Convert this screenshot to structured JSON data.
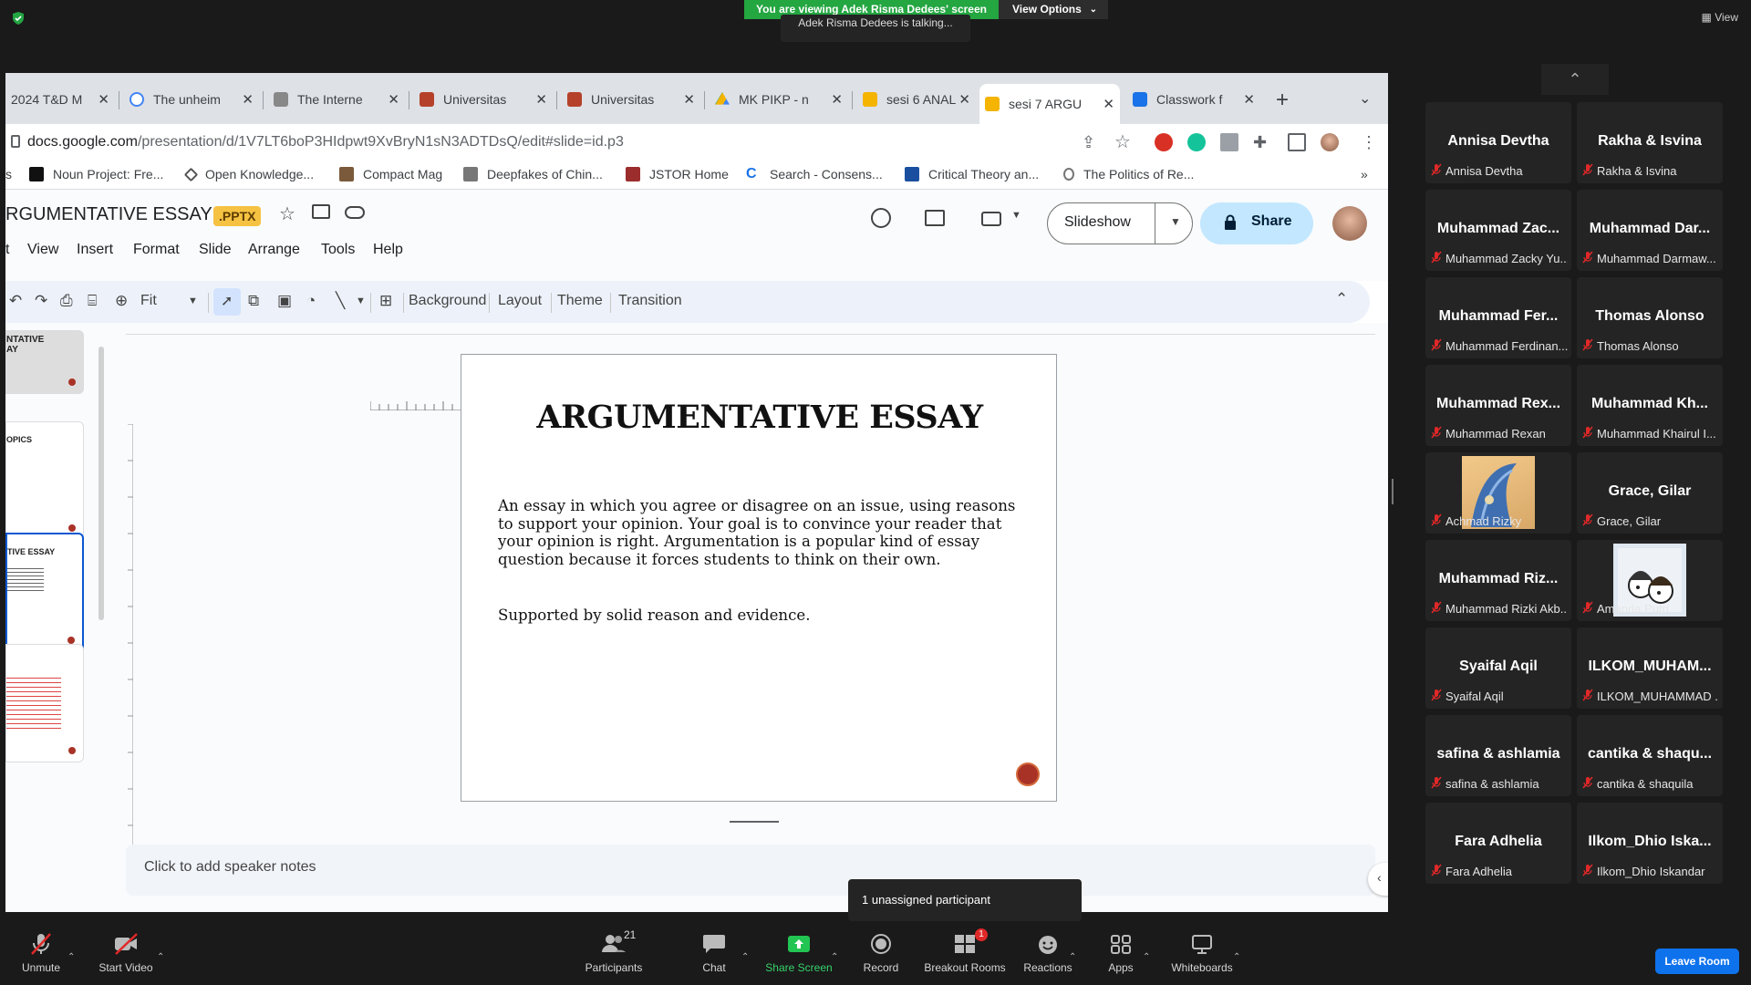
{
  "zoom": {
    "viewing_banner": "You are viewing Adek Risma Dedees' screen",
    "view_options": "View Options",
    "talking": "Adek Risma Dedees is talking...",
    "top_view": "View"
  },
  "browser": {
    "tabs": [
      {
        "label": "2024 T&D M",
        "color": "#c8c8c8"
      },
      {
        "label": "The unheim",
        "color": "#4285f4"
      },
      {
        "label": "The Interne",
        "color": "#888888"
      },
      {
        "label": "Universitas",
        "color": "#b5412a"
      },
      {
        "label": "Universitas",
        "color": "#b5412a"
      },
      {
        "label": "MK PIKP - n",
        "color": "#0f9d58"
      },
      {
        "label": "sesi 6 ANAL",
        "color": "#f4b400"
      },
      {
        "label": "sesi 7 ARGU",
        "color": "#f4b400"
      },
      {
        "label": "Classwork f",
        "color": "#1a73e8"
      }
    ],
    "url_host": "docs.google.com",
    "url_path": "/presentation/d/1V7LT6boP3HIdpwt9XvBryN1sN3ADTDsQ/edit#slide=id.p3",
    "bookmarks": [
      {
        "label": "s"
      },
      {
        "label": "Noun Project: Fre..."
      },
      {
        "label": "Open Knowledge..."
      },
      {
        "label": "Compact Mag"
      },
      {
        "label": "Deepfakes of Chin..."
      },
      {
        "label": "JSTOR Home"
      },
      {
        "label": "Search - Consens..."
      },
      {
        "label": "Critical Theory an..."
      },
      {
        "label": "The Politics of Re..."
      }
    ],
    "bookmarks_more": "»"
  },
  "slides": {
    "doc_title": "RGUMENTATIVE ESSAY",
    "badge": ".PPTX",
    "menus": [
      "t",
      "View",
      "Insert",
      "Format",
      "Slide",
      "Arrange",
      "Tools",
      "Help"
    ],
    "slideshow": "Slideshow",
    "share": "Share",
    "zoom": "Fit",
    "toolbar_text": [
      "Background",
      "Layout",
      "Theme",
      "Transition"
    ],
    "thumbnails": [
      "NTATIVE\nAY",
      "OPICS",
      "TIVE ESSAY",
      ""
    ],
    "slide_title": "ARGUMENTATIVE ESSAY",
    "slide_body": "An essay in which you agree or disagree on an issue, using reasons to support your opinion. Your goal is to convince your reader that your opinion is right. Argumentation is a popular kind of essay question because it forces students to think on their own.",
    "slide_body2": "Supported by solid reason and evidence.",
    "speaker_notes": "Click to add speaker notes"
  },
  "gallery": [
    {
      "big": "Annisa Devtha",
      "small": "Annisa Devtha"
    },
    {
      "big": "Rakha & Isvina",
      "small": "Rakha & Isvina"
    },
    {
      "big": "Muhammad Zac...",
      "small": "Muhammad Zacky Yu..."
    },
    {
      "big": "Muhammad Dar...",
      "small": "Muhammad Darmaw..."
    },
    {
      "big": "Muhammad Fer...",
      "small": "Muhammad Ferdinan..."
    },
    {
      "big": "Thomas Alonso",
      "small": "Thomas Alonso"
    },
    {
      "big": "Muhammad Rex...",
      "small": "Muhammad Rexan"
    },
    {
      "big": "Muhammad Kh...",
      "small": "Muhammad Khairul I..."
    },
    {
      "big": "",
      "small": "Achmad Rizky",
      "photo": "bird"
    },
    {
      "big": "Grace, Gilar",
      "small": "Grace, Gilar"
    },
    {
      "big": "Muhammad Riz...",
      "small": "Muhammad Rizki Akb..."
    },
    {
      "big": "",
      "small": "Amanda Putri",
      "photo": "anime"
    },
    {
      "big": "Syaifal Aqil",
      "small": "Syaifal Aqil"
    },
    {
      "big": "ILKOM_MUHAM...",
      "small": "ILKOM_MUHAMMAD ..."
    },
    {
      "big": "safina & ashlamia",
      "small": "safina & ashlamia"
    },
    {
      "big": "cantika & shaqu...",
      "small": "cantika & shaquila"
    },
    {
      "big": "Fara Adhelia",
      "small": "Fara Adhelia"
    },
    {
      "big": "Ilkom_Dhio Iska...",
      "small": "Ilkom_Dhio Iskandar"
    }
  ],
  "toast": "1 unassigned participant",
  "bottombar": {
    "unmute": "Unmute",
    "start_video": "Start Video",
    "participants": "Participants",
    "participants_count": "21",
    "chat": "Chat",
    "share_screen": "Share Screen",
    "record": "Record",
    "breakout_rooms": "Breakout Rooms",
    "breakout_badge": "1",
    "reactions": "Reactions",
    "apps": "Apps",
    "whiteboards": "Whiteboards",
    "leave_room": "Leave Room"
  }
}
